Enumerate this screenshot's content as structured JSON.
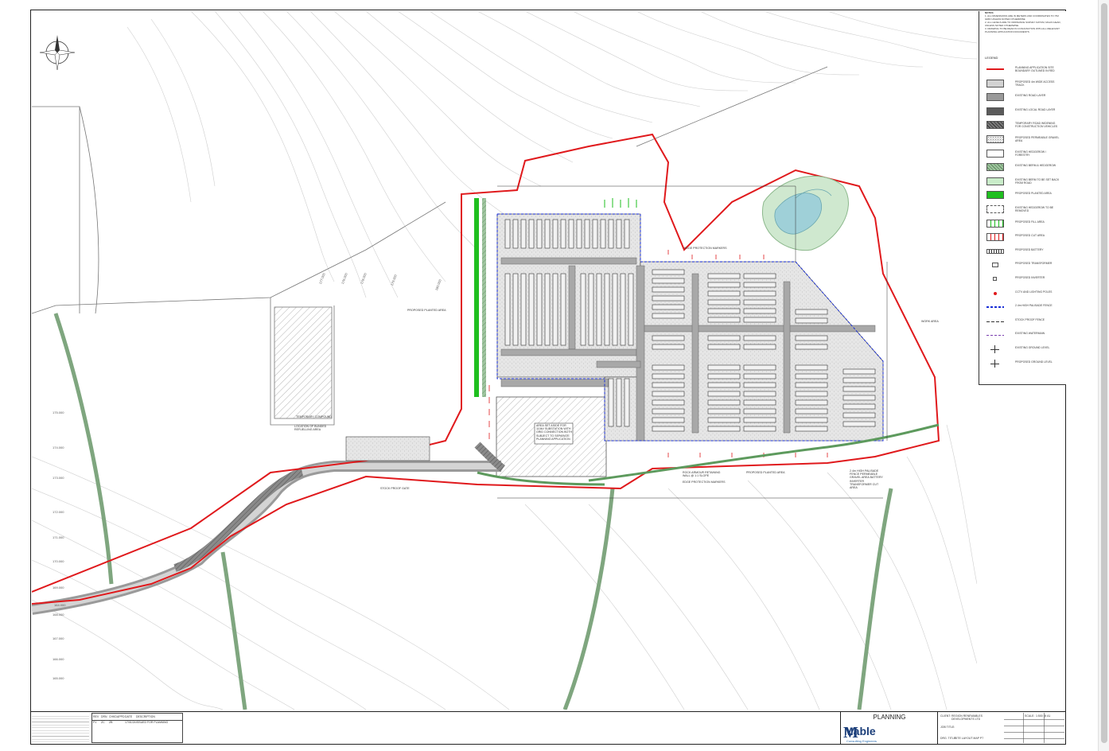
{
  "drawing": {
    "status": "PLANNING",
    "company_logo": "Mable",
    "company_logo_suffix": "Consulting Engineers",
    "drawing_title_label": "DRG. TITLE:",
    "drawing_title": "SITE LAYOUT MAP P7",
    "client_label": "CLIENT:",
    "client": "REGION RENEWABLES DEVELOPMENTS LTD",
    "job_title_label": "JOB TITLE:",
    "scale_label": "SCALE:",
    "scale": "1:500 @ A1"
  },
  "revision_table": {
    "headers": [
      "REV",
      "DRN",
      "CHKD",
      "APPD",
      "DATE",
      "DESCRIPTION"
    ],
    "rows": [
      [
        "P1",
        "ZC",
        "ZB",
        "",
        "17/01/24",
        "ISSUED FOR PLANNING"
      ]
    ]
  },
  "legend": {
    "title": "LEGEND",
    "notes_title": "NOTES:",
    "notes": [
      "1. ALL DIMENSIONS ARE IN METERS AND COORDINATES TO ITM GRID UNLESS NOTED OTHERWISE",
      "2. ALL LEVELS ARE TO ORDNANCE SURVEY DATUM, MALIN HEAD, UNLESS NOTED OTHERWISE",
      "3. DRAWING TO BE READ IN CONJUNCTION WITH ALL RELEVANT PLANNING APPLICATION DOCUMENTS"
    ],
    "items": [
      {
        "label": "PLANNING APPLICATION SITE BOUNDARY OUTLINED IN RED",
        "swatch": "line-red"
      },
      {
        "label": "PROPOSED 4m WIDE ACCESS TRACK",
        "swatch": "light-grey"
      },
      {
        "label": "EXISTING ROAD LAYER",
        "swatch": "mid-grey"
      },
      {
        "label": "EXISTING LOCAL ROAD LAYER",
        "swatch": "dark-grey"
      },
      {
        "label": "TEMPORARY ROAD WIDENING FOR CONSTRUCTION VEHICLES",
        "swatch": "hatched-dark"
      },
      {
        "label": "PROPOSED PERMEABLE GRAVEL AREA",
        "swatch": "speckle"
      },
      {
        "label": "EXISTING HEDGEROW / FORESTRY",
        "swatch": "white"
      },
      {
        "label": "EXISTING BERM & HEDGEROW",
        "swatch": "green-hatch"
      },
      {
        "label": "EXISTING BERM TO BE SET BACK FROM ROAD",
        "swatch": "pale-green"
      },
      {
        "label": "PROPOSED PLANTED AREA",
        "swatch": "green"
      },
      {
        "label": "EXISTING HEDGEROW TO BE REMOVED",
        "swatch": "dashed"
      },
      {
        "label": "PROPOSED FILL AREA",
        "swatch": "fill-ticks"
      },
      {
        "label": "PROPOSED CUT AREA",
        "swatch": "cut-ticks"
      },
      {
        "label": "PROPOSED BATTERY",
        "swatch": "battery"
      },
      {
        "label": "PROPOSED TRANSFORMER",
        "swatch": "small-box"
      },
      {
        "label": "PROPOSED INVERTER",
        "swatch": "tiny-box"
      },
      {
        "label": "CCTV AND LIGHTING POLES",
        "swatch": "red-dot"
      },
      {
        "label": "2.4m HIGH PALISADE FENCE",
        "swatch": "blue-fence"
      },
      {
        "label": "STOCK PROOF FENCE",
        "swatch": "stock-fence"
      },
      {
        "label": "EXISTING WATERMAIN",
        "swatch": "purple-dash"
      },
      {
        "label": "EXISTING GROUND LEVEL",
        "swatch": "level-mark"
      },
      {
        "label": "PROPOSED GROUND LEVEL",
        "swatch": "level-mark"
      }
    ]
  },
  "map_labels": {
    "planted_area_1": "PROPOSED PLANTED AREA",
    "temp_compound": "TEMPORARY COMPOUND",
    "bunded_area": "LOCATION OF BUNDED REFUELLING AREA",
    "stock_proof_gate": "STOCK PROOF GATE",
    "work_area": "WORK AREA",
    "edge_markers_top": "EDGE PROTECTION MARKERS",
    "edge_markers_bottom": "EDGE PROTECTION MARKERS",
    "rock_armour": "ROCK ARMOUR RETAINING WALL @ 1:1 SLOPE",
    "planted_area_2": "PROPOSED PLANTED AREA",
    "future_area": "AREA SET ASIDE FOR 110kV SUBSTATION WITH GRID CONNECTION BOTH SUBJECT TO SEPARATE PLANNING APPLICATION",
    "palisade_note": "2.4m HIGH PALISADE FENCE PERMEABLE GRAVEL AREA BATTERY INVERTER TRANSFORMER CUT AREA"
  },
  "contour_labels": [
    "180.000",
    "175.000",
    "174.000",
    "173.000",
    "172.000",
    "171.000",
    "170.000",
    "169.000",
    "168.000",
    "167.000",
    "166.000",
    "165.000",
    "164.000",
    "177.000",
    "176.000",
    "178.000",
    "179.000"
  ],
  "colors": {
    "boundary": "#e0191c",
    "planted": "#1fbf1f",
    "fence": "#1a2fd6",
    "track": "#c9c9c9",
    "forest_band": "#7fa67f",
    "brand": "#1c3f7a"
  }
}
